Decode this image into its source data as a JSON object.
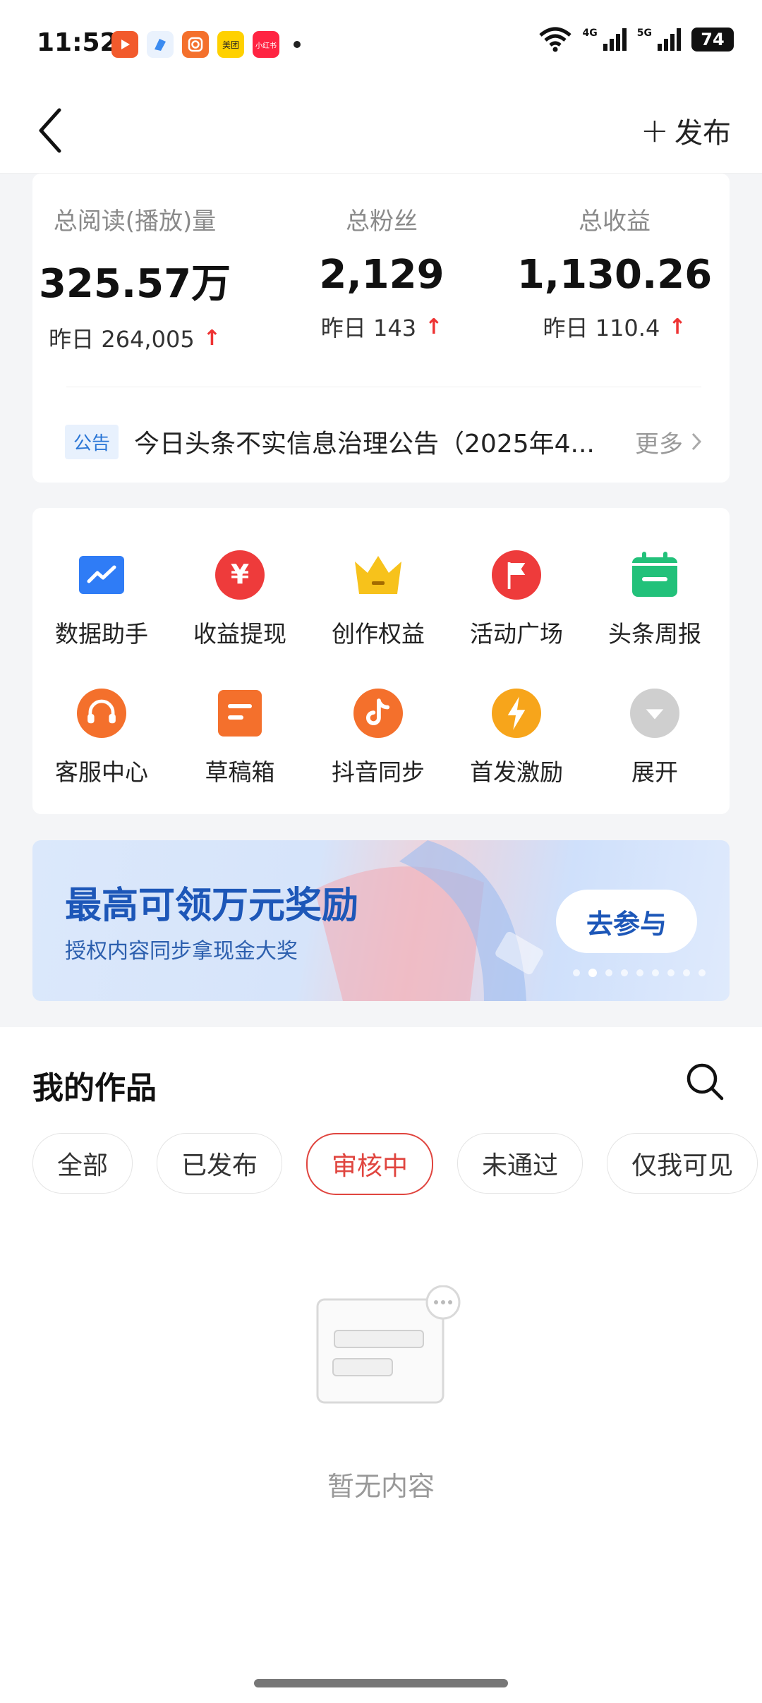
{
  "status_bar": {
    "time": "11:52",
    "app_icons": [
      "video-app-icon",
      "blue-app-icon",
      "camera-app-icon",
      "meituan-app-icon",
      "xiaohongshu-app-icon"
    ],
    "meituan_label": "美团",
    "xiaohongshu_label": "小红书",
    "signal_4g": "4G",
    "signal_5g": "5G",
    "battery": "74"
  },
  "nav": {
    "publish_label": "发布"
  },
  "stats": [
    {
      "label": "总阅读(播放)量",
      "value": "325.57万",
      "yesterday": "昨日 264,005"
    },
    {
      "label": "总粉丝",
      "value": "2,129",
      "yesterday": "昨日 143"
    },
    {
      "label": "总收益",
      "value": "1,130.26",
      "yesterday": "昨日 110.4"
    }
  ],
  "notice": {
    "tag": "公告",
    "text": "今日头条不实信息治理公告（2025年4...",
    "more": "更多"
  },
  "tools": [
    {
      "label": "数据助手",
      "icon": "chart-icon",
      "color": "#2f7cf6"
    },
    {
      "label": "收益提现",
      "icon": "yen-icon",
      "color": "#ee3b3b"
    },
    {
      "label": "创作权益",
      "icon": "crown-icon",
      "color": "#f7c21b"
    },
    {
      "label": "活动广场",
      "icon": "flag-icon",
      "color": "#ee3b3b"
    },
    {
      "label": "头条周报",
      "icon": "calendar-icon",
      "color": "#22c17a"
    },
    {
      "label": "客服中心",
      "icon": "headset-icon",
      "color": "#f4702c"
    },
    {
      "label": "草稿箱",
      "icon": "draft-icon",
      "color": "#f4702c"
    },
    {
      "label": "抖音同步",
      "icon": "douyin-icon",
      "color": "#f4702c"
    },
    {
      "label": "首发激励",
      "icon": "lightning-icon",
      "color": "#f7a51b"
    },
    {
      "label": "展开",
      "icon": "expand-icon",
      "color": "#c8c8c8"
    }
  ],
  "banner": {
    "title": "最高可领万元奖励",
    "subtitle": "授权内容同步拿现金大奖",
    "button": "去参与",
    "dots_total": 9,
    "dots_active": 1
  },
  "works": {
    "title": "我的作品",
    "tabs": [
      "全部",
      "已发布",
      "审核中",
      "未通过",
      "仅我可见"
    ],
    "active_tab": "审核中",
    "empty_text": "暂无内容"
  }
}
